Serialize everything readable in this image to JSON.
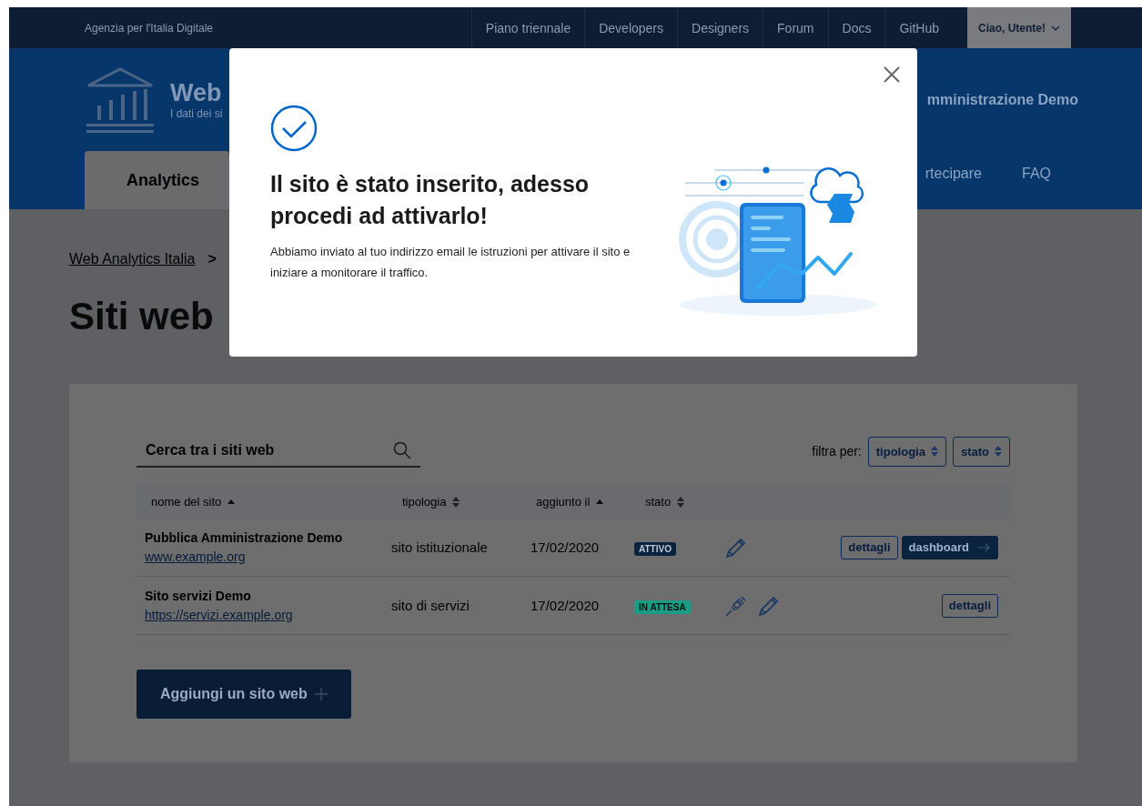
{
  "top_bar": {
    "organization": "Agenzia per l'Italia Digitale",
    "links": [
      "Piano triennale",
      "Developers",
      "Designers",
      "Forum",
      "Docs",
      "GitHub"
    ],
    "user_menu": {
      "label": "Ciao, Utente!"
    }
  },
  "header": {
    "title": "Web",
    "subtitle": "I dati dei si",
    "owner": "mministrazione Demo",
    "nav": [
      {
        "label": "Analytics",
        "selected": true
      },
      {
        "label": "rtecipare",
        "selected": false
      },
      {
        "label": "FAQ",
        "selected": false
      }
    ]
  },
  "breadcrumb": {
    "link": "Web Analytics Italia",
    "separator": ">"
  },
  "page_title": "Siti web",
  "search": {
    "placeholder": "Cerca tra i siti web"
  },
  "filters": {
    "label": "filtra per:",
    "selects": [
      "tipologia",
      "stato"
    ]
  },
  "table": {
    "columns": [
      {
        "label": "nome del sito",
        "sorted_ascending": true
      },
      {
        "label": "tipologia",
        "sorted_ascending": false
      },
      {
        "label": "aggiunto il",
        "sorted_ascending": true
      },
      {
        "label": "stato",
        "sorted_ascending": false
      }
    ],
    "rows": [
      {
        "name": "Pubblica Amministrazione Demo",
        "url": "www.example.org",
        "type": "sito istituzionale",
        "added": "17/02/2020",
        "status": {
          "label": "ATTIVO",
          "kind": "active"
        },
        "actions": [
          {
            "kind": "edit"
          }
        ],
        "buttons": [
          {
            "label": "dettagli",
            "kind": "outline"
          },
          {
            "label": "dashboard",
            "kind": "primary"
          }
        ]
      },
      {
        "name": "Sito servizi Demo",
        "url": "https://servizi.example.org",
        "type": "sito di servizi",
        "added": "17/02/2020",
        "status": {
          "label": "IN ATTESA",
          "kind": "pending"
        },
        "actions": [
          {
            "kind": "plug"
          },
          {
            "kind": "edit"
          }
        ],
        "buttons": [
          {
            "label": "dettagli",
            "kind": "outline"
          }
        ]
      }
    ]
  },
  "add_button": {
    "label": "Aggiungi un sito web"
  },
  "modal": {
    "title": "Il sito è stato inserito, adesso procedi ad attivarlo!",
    "body": "Abbiamo inviato al tuo indirizzo email le istruzioni per attivare il sito e iniziare a monitorare il traffico."
  }
}
